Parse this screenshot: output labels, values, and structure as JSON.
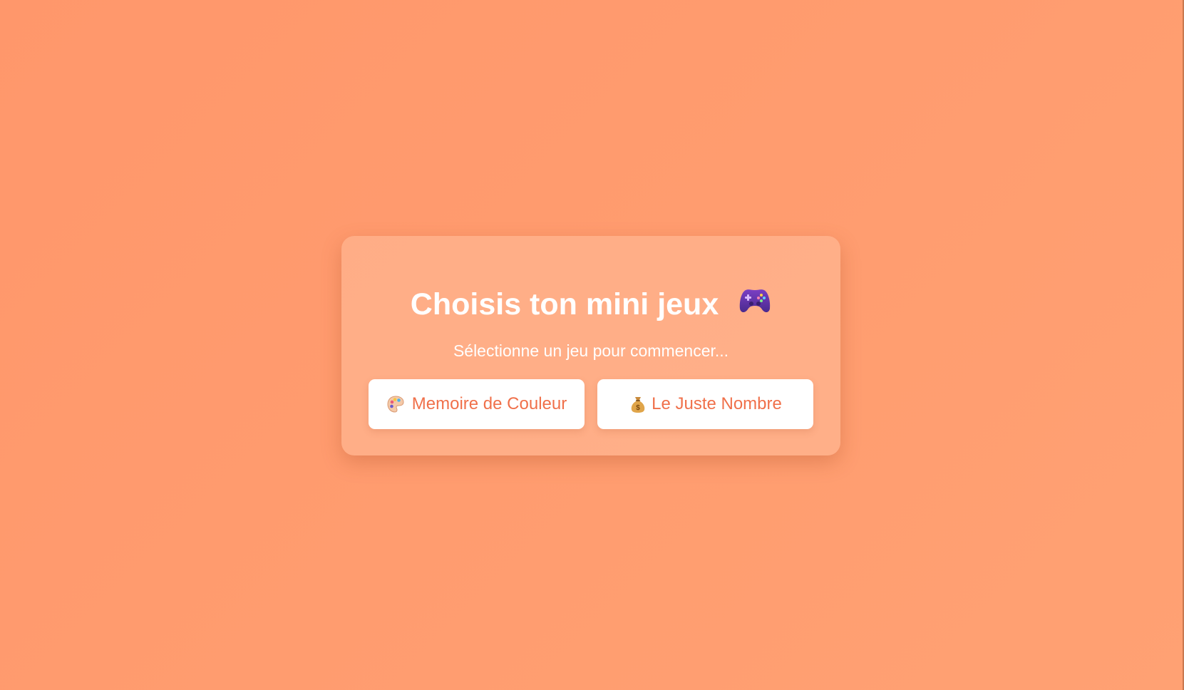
{
  "menu": {
    "title": "Choisis ton mini jeux",
    "title_icon": "game-controller-icon",
    "subtitle": "Sélectionne un jeu pour commencer...",
    "games": [
      {
        "label": "Memoire de Couleur",
        "icon": "palette-icon"
      },
      {
        "label": "Le Juste Nombre",
        "icon": "money-bag-icon"
      }
    ]
  },
  "colors": {
    "background": "#ff9a6e",
    "button_text": "#f0704a",
    "button_bg": "#ffffff",
    "title_text": "#ffffff"
  }
}
